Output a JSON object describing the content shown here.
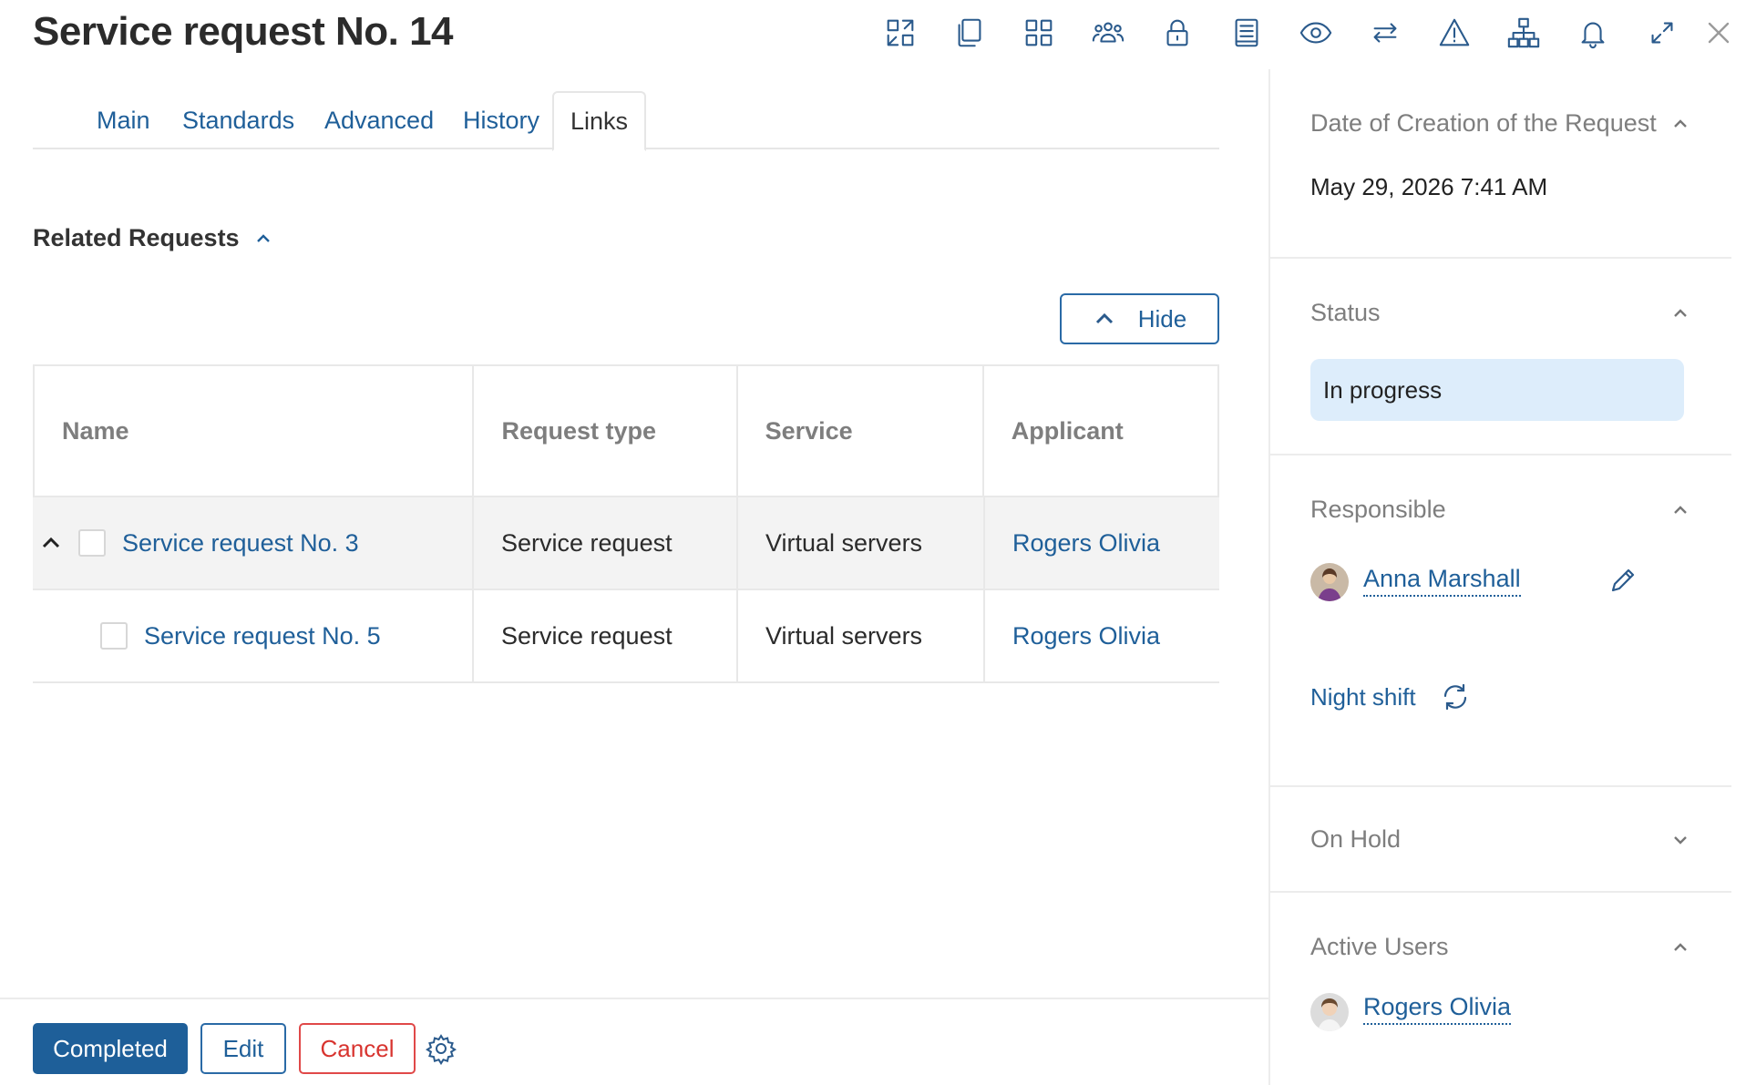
{
  "header": {
    "title": "Service request No. 14"
  },
  "toolbar": {
    "icons": [
      "transfer-icon",
      "copy-icon",
      "apps-grid-icon",
      "team-icon",
      "lock-icon",
      "journal-icon",
      "eye-icon",
      "swap-icon",
      "warning-icon",
      "hierarchy-icon",
      "bell-icon",
      "expand-icon",
      "close-icon"
    ]
  },
  "tabs": [
    {
      "label": "Main"
    },
    {
      "label": "Standards"
    },
    {
      "label": "Advanced"
    },
    {
      "label": "History"
    },
    {
      "label": "Links",
      "active": true
    }
  ],
  "related": {
    "title": "Related Requests",
    "hide_label": "Hide",
    "columns": [
      "Name",
      "Request type",
      "Service",
      "Applicant"
    ],
    "rows": [
      {
        "name": "Service request No. 3",
        "type": "Service request",
        "service": "Virtual servers",
        "applicant": "Rogers Olivia",
        "expanded": true
      },
      {
        "name": "Service request No. 5",
        "type": "Service request",
        "service": "Virtual servers",
        "applicant": "Rogers Olivia",
        "child": true
      }
    ]
  },
  "footer": {
    "completed_label": "Completed",
    "edit_label": "Edit",
    "cancel_label": "Cancel"
  },
  "sidebar": {
    "creation": {
      "title": "Date of Creation of the Request",
      "value": "May 29, 2026 7:41 AM"
    },
    "status": {
      "title": "Status",
      "value": "In progress"
    },
    "responsible": {
      "title": "Responsible",
      "user": "Anna Marshall",
      "group": "Night shift"
    },
    "on_hold": {
      "title": "On Hold"
    },
    "active_users": {
      "title": "Active Users",
      "user": "Rogers Olivia"
    }
  },
  "colors": {
    "accent": "#1e5f99",
    "cancel": "#d8342f",
    "status_bg": "#ddedfb"
  }
}
